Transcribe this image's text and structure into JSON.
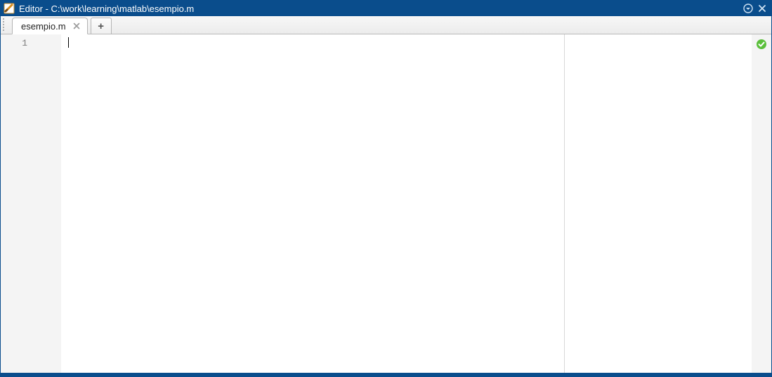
{
  "titlebar": {
    "title": "Editor - C:\\work\\learning\\matlab\\esempio.m"
  },
  "tabs": {
    "active": {
      "label": "esempio.m"
    }
  },
  "gutter": {
    "line1": "1"
  }
}
